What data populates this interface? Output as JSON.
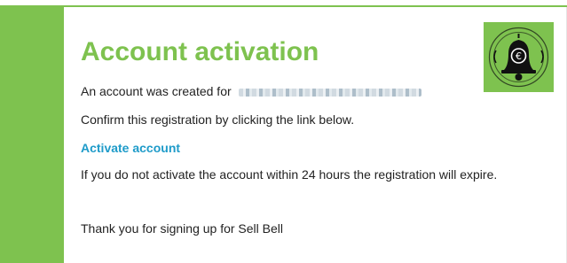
{
  "email": {
    "title": "Account activation",
    "created_prefix": "An account was created for",
    "recipient_redacted": "",
    "confirm_text": "Confirm this registration by clicking the link below.",
    "activate_link": "Activate account",
    "expire_text": "If you do not activate the account within 24 hours the registration will expire.",
    "thanks_text": "Thank you for signing up for Sell Bell"
  },
  "logo": {
    "icon": "bell-icon",
    "symbol": "€"
  },
  "colors": {
    "brand_green": "#7ec24f",
    "link_blue": "#1e9bc9",
    "text": "#222222"
  }
}
